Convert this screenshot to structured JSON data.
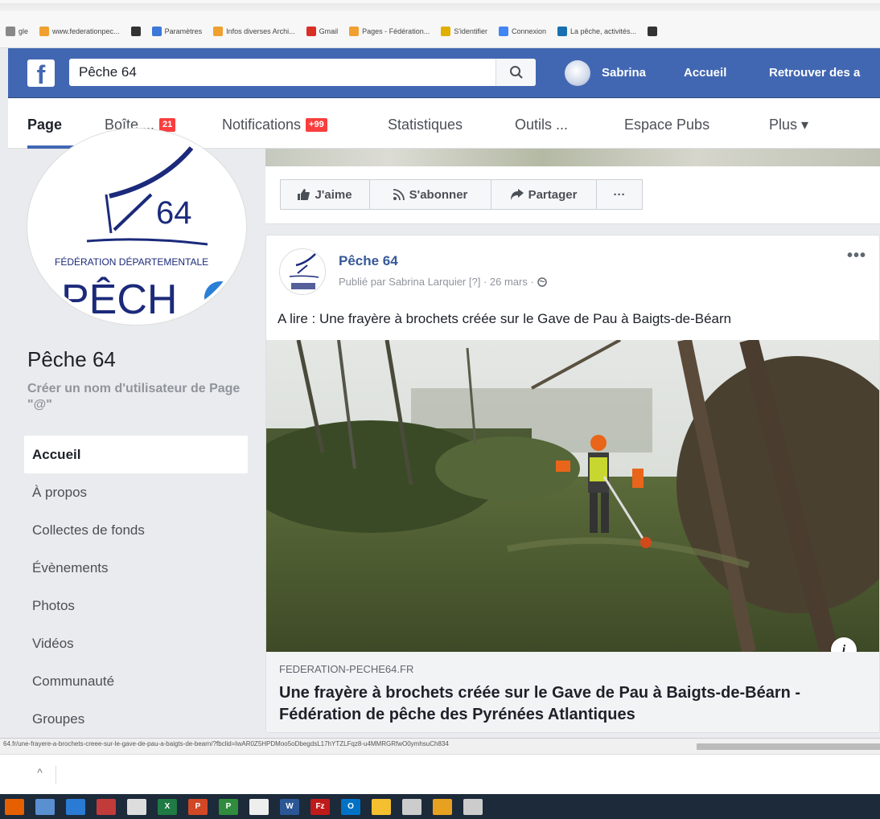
{
  "browser": {
    "bookmarks": [
      {
        "label": "gle",
        "icon": "bookmark-icon",
        "color": "#888888"
      },
      {
        "label": "www.federationpec...",
        "icon": "bookmark-icon",
        "color": "#f0a030"
      },
      {
        "label": "",
        "icon": "globe-icon",
        "color": "#333333"
      },
      {
        "label": "Paramètres",
        "icon": "gear-icon",
        "color": "#3b78d8"
      },
      {
        "label": "Infos diverses Archi...",
        "icon": "bookmark-icon",
        "color": "#f0a030"
      },
      {
        "label": "Gmail",
        "icon": "gmail-icon",
        "color": "#d93025"
      },
      {
        "label": "Pages - Fédération...",
        "icon": "bookmark-icon",
        "color": "#f0a030"
      },
      {
        "label": "S'identifier",
        "icon": "pen-icon",
        "color": "#e0b000"
      },
      {
        "label": "Connexion",
        "icon": "google-icon",
        "color": "#4285f4"
      },
      {
        "label": "La pêche, activités...",
        "icon": "bookmark-icon",
        "color": "#1a6fb0"
      },
      {
        "label": "",
        "icon": "globe-icon",
        "color": "#333333"
      }
    ],
    "status_url": "64.fr/une-frayere-a-brochets-creee-sur-le-gave-de-pau-a-baigts-de-bearn/?fbclid=IwAR0Z5HPDMoo5oDbegdsL17hYTZLFqz8-u4MMRGRfwO0ymhsuCh834"
  },
  "fb": {
    "logo": "f",
    "search_value": "Pêche 64",
    "user": "Sabrina",
    "home": "Accueil",
    "find": "Retrouver des a",
    "colors": {
      "brand": "#4267b2",
      "link": "#365899",
      "badge": "#fa3e3e"
    }
  },
  "tabs": [
    {
      "label": "Page",
      "badge": ""
    },
    {
      "label": "Boîte ...",
      "badge": "21"
    },
    {
      "label": "Notifications",
      "badge": "+99"
    },
    {
      "label": "Statistiques",
      "badge": ""
    },
    {
      "label": "Outils ...",
      "badge": ""
    },
    {
      "label": "Espace Pubs",
      "badge": ""
    },
    {
      "label": "Plus ▾",
      "badge": ""
    }
  ],
  "page": {
    "logo_number": "64",
    "logo_caption": "FÉDÉRATION DÉPARTEMENTALE",
    "logo_word": "PÊCH",
    "name": "Pêche 64",
    "username_prompt": "Créer un nom d'utilisateur de Page \"@\"",
    "nav": [
      "Accueil",
      "À propos",
      "Collectes de fonds",
      "Évènements",
      "Photos",
      "Vidéos",
      "Communauté",
      "Groupes"
    ]
  },
  "actions": {
    "like": "J'aime",
    "follow": "S'abonner",
    "share": "Partager",
    "more": "···"
  },
  "post": {
    "author": "Pêche 64",
    "meta": "Publié par Sabrina Larquier [?] · 26 mars ·",
    "more": "•••",
    "text": "A lire : Une frayère à brochets créée sur le Gave de Pau à Baigts-de-Béarn",
    "link_domain": "FEDERATION-PECHE64.FR",
    "link_title": "Une frayère à brochets créée sur le Gave de Pau à Baigts-de-Béarn - Fédération de pêche des Pyrénées Atlantiques",
    "info": "i"
  },
  "downloads": {
    "chevron": "^"
  },
  "taskbar": [
    {
      "icon": "firefox-icon",
      "color": "#e66000",
      "label": ""
    },
    {
      "icon": "paint-icon",
      "color": "#5a8fd0",
      "label": ""
    },
    {
      "icon": "image-icon",
      "color": "#2a7bd4",
      "label": ""
    },
    {
      "icon": "publisher-icon",
      "color": "#c13b3b",
      "label": ""
    },
    {
      "icon": "document-icon",
      "color": "#dddddd",
      "label": ""
    },
    {
      "icon": "excel-icon",
      "color": "#1f7a44",
      "label": "X"
    },
    {
      "icon": "powerpoint-icon",
      "color": "#d24726",
      "label": "P"
    },
    {
      "icon": "project-icon",
      "color": "#2f8c3c",
      "label": "P"
    },
    {
      "icon": "store-icon",
      "color": "#eeeeee",
      "label": ""
    },
    {
      "icon": "word-icon",
      "color": "#2b5797",
      "label": "W"
    },
    {
      "icon": "filezilla-icon",
      "color": "#bf1a1a",
      "label": "Fz"
    },
    {
      "icon": "outlook-icon",
      "color": "#0072c6",
      "label": "O"
    },
    {
      "icon": "folder-icon",
      "color": "#f4c030",
      "label": ""
    },
    {
      "icon": "network-icon",
      "color": "#cccccc",
      "label": ""
    },
    {
      "icon": "chrome-icon",
      "color": "#e8a020",
      "label": ""
    },
    {
      "icon": "cloud-icon",
      "color": "#cccccc",
      "label": ""
    }
  ]
}
